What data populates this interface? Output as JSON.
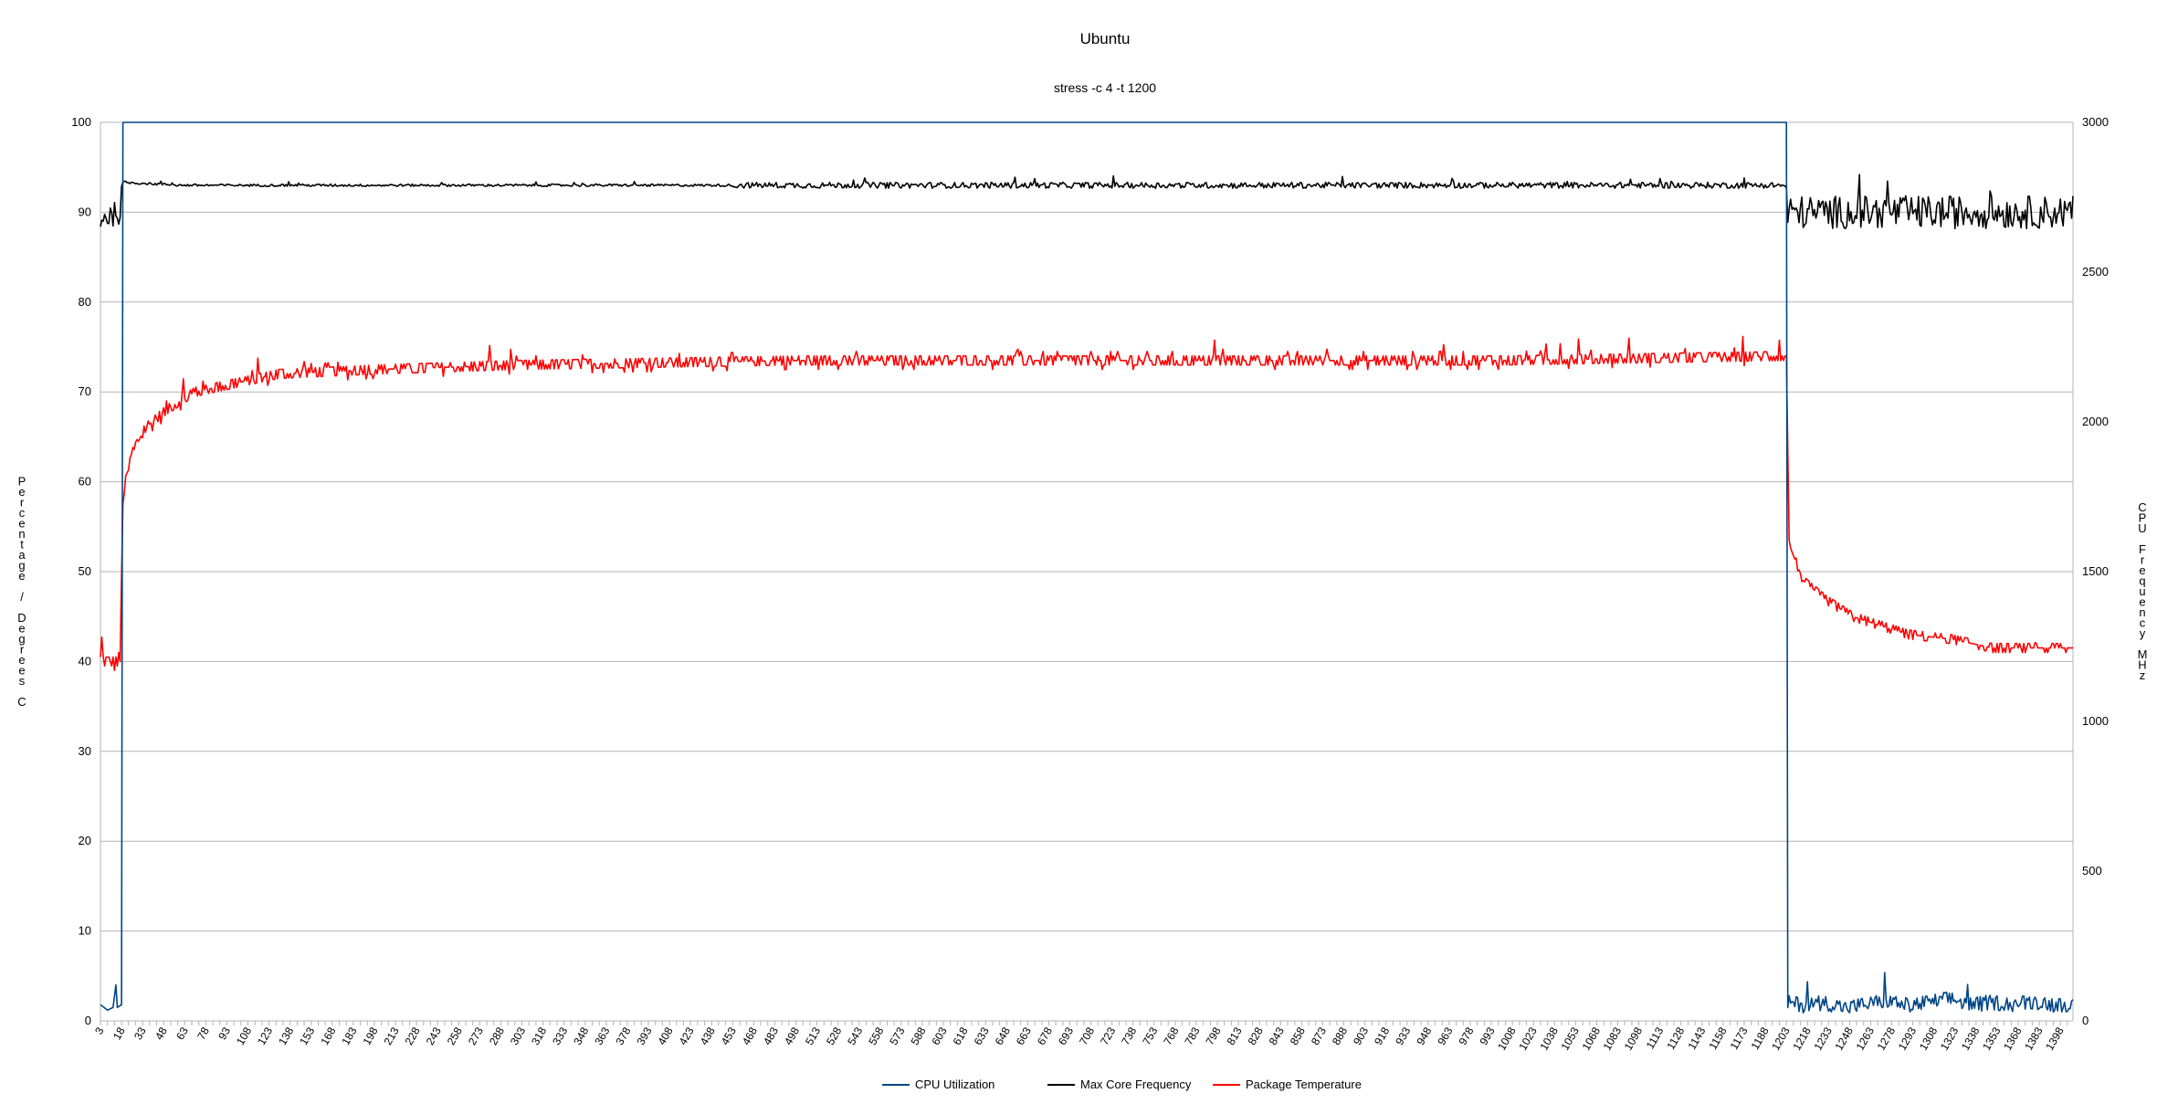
{
  "chart_data": {
    "type": "line",
    "title": "Ubuntu",
    "subtitle": "stress -c 4 -t 1200",
    "ylabel_left": "Percentage / Degrees C",
    "ylabel_right": "CPU Frequency MHz",
    "xlabel": "",
    "x_range": [
      3,
      1407
    ],
    "x_ticks": [
      3,
      18,
      33,
      48,
      63,
      78,
      93,
      108,
      123,
      138,
      153,
      168,
      183,
      198,
      213,
      228,
      243,
      258,
      273,
      288,
      303,
      318,
      333,
      348,
      363,
      378,
      393,
      408,
      423,
      438,
      453,
      468,
      483,
      498,
      513,
      528,
      543,
      558,
      573,
      588,
      603,
      618,
      633,
      648,
      663,
      678,
      693,
      708,
      723,
      738,
      753,
      768,
      783,
      798,
      813,
      828,
      843,
      858,
      873,
      888,
      903,
      918,
      933,
      948,
      963,
      978,
      993,
      1008,
      1023,
      1038,
      1053,
      1068,
      1083,
      1098,
      1113,
      1128,
      1143,
      1158,
      1173,
      1188,
      1203,
      1218,
      1233,
      1248,
      1263,
      1278,
      1293,
      1308,
      1323,
      1338,
      1353,
      1368,
      1383,
      1398
    ],
    "ylim_left": [
      0,
      100
    ],
    "yticks_left": [
      0,
      10,
      20,
      30,
      40,
      50,
      60,
      70,
      80,
      90,
      100
    ],
    "ylim_right": [
      0,
      3000
    ],
    "yticks_right": [
      0,
      500,
      1000,
      1500,
      2000,
      2500,
      3000
    ],
    "grid": true,
    "legend_position": "bottom",
    "series": [
      {
        "name": "CPU Utilization",
        "axis": "left",
        "color": "#004586",
        "points": [
          [
            3,
            1.8
          ],
          [
            8,
            1.2
          ],
          [
            12,
            1.5
          ],
          [
            14,
            4.0
          ],
          [
            15,
            1.5
          ],
          [
            18,
            1.8
          ],
          [
            19,
            100
          ],
          [
            1203,
            100
          ],
          [
            1204,
            1.8
          ],
          [
            1215,
            1.5
          ],
          [
            1230,
            1.8
          ],
          [
            1245,
            1.2
          ],
          [
            1260,
            1.6
          ],
          [
            1275,
            2.0
          ],
          [
            1290,
            1.4
          ],
          [
            1305,
            1.8
          ],
          [
            1320,
            2.2
          ],
          [
            1335,
            1.5
          ],
          [
            1350,
            1.8
          ],
          [
            1365,
            1.6
          ],
          [
            1380,
            1.9
          ],
          [
            1395,
            1.5
          ],
          [
            1407,
            1.7
          ]
        ],
        "noise": {
          "start": 1204,
          "end": 1407,
          "amplitude": 1.1
        }
      },
      {
        "name": "Max Core Frequency",
        "axis": "right",
        "color": "#000000",
        "points": [
          [
            3,
            2680
          ],
          [
            17,
            2700
          ],
          [
            19,
            2800
          ],
          [
            60,
            2790
          ],
          [
            200,
            2790
          ],
          [
            400,
            2790
          ],
          [
            600,
            2790
          ],
          [
            800,
            2790
          ],
          [
            1000,
            2790
          ],
          [
            1200,
            2790
          ],
          [
            1203,
            2780
          ],
          [
            1204,
            2700
          ],
          [
            1300,
            2700
          ],
          [
            1407,
            2700
          ]
        ],
        "noise": [
          {
            "start": 3,
            "end": 18,
            "amplitude": 40
          },
          {
            "start": 19,
            "end": 450,
            "amplitude": 4
          },
          {
            "start": 451,
            "end": 1202,
            "amplitude": 10
          },
          {
            "start": 1204,
            "end": 1407,
            "amplitude": 55
          }
        ]
      },
      {
        "name": "Package Temperature",
        "axis": "left",
        "color": "#ff0000",
        "points": [
          [
            3,
            40
          ],
          [
            17,
            40
          ],
          [
            19,
            58
          ],
          [
            25,
            63
          ],
          [
            35,
            66
          ],
          [
            50,
            68
          ],
          [
            70,
            70
          ],
          [
            100,
            71
          ],
          [
            130,
            72
          ],
          [
            200,
            72.5
          ],
          [
            300,
            73
          ],
          [
            500,
            73.5
          ],
          [
            800,
            73.5
          ],
          [
            1000,
            73.5
          ],
          [
            1203,
            74
          ],
          [
            1205,
            53
          ],
          [
            1215,
            49
          ],
          [
            1230,
            47
          ],
          [
            1250,
            45
          ],
          [
            1270,
            44
          ],
          [
            1290,
            43
          ],
          [
            1320,
            42.5
          ],
          [
            1350,
            41.5
          ],
          [
            1407,
            41.5
          ]
        ],
        "noise": [
          {
            "start": 3,
            "end": 18,
            "amplitude": 1.0
          },
          {
            "start": 19,
            "end": 1202,
            "amplitude": 0.8
          },
          {
            "start": 1205,
            "end": 1407,
            "amplitude": 0.5
          }
        ]
      }
    ]
  }
}
